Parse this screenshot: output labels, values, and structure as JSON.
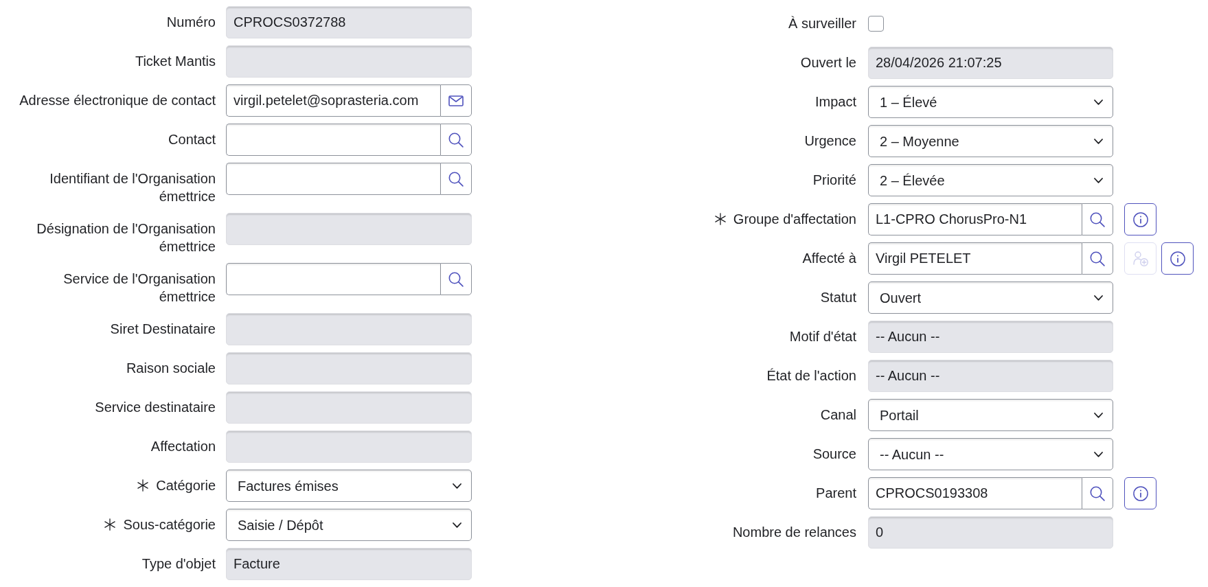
{
  "left_fields": [
    {
      "label": "Numéro",
      "kind": "readonly",
      "required": false,
      "value": "CPROCS0372788"
    },
    {
      "label": "Ticket Mantis",
      "kind": "readonly",
      "required": false
    },
    {
      "label": "Adresse électronique de contact",
      "kind": "email",
      "required": false,
      "value": "virgil.petelet@soprasteria.com"
    },
    {
      "label": "Contact",
      "kind": "lookup",
      "required": false
    },
    {
      "label": "Identifiant de l'Organisation émettrice",
      "kind": "lookup",
      "required": false
    },
    {
      "label": "Désignation de l'Organisation émettrice",
      "kind": "readonly",
      "required": false
    },
    {
      "label": "Service de l'Organisation émettrice",
      "kind": "lookup",
      "required": false
    },
    {
      "label": "Siret Destinataire",
      "kind": "readonly",
      "required": false
    },
    {
      "label": "Raison sociale",
      "kind": "readonly",
      "required": false
    },
    {
      "label": "Service destinataire",
      "kind": "readonly",
      "required": false
    },
    {
      "label": "Affectation",
      "kind": "readonly",
      "required": false
    },
    {
      "label": "Catégorie",
      "kind": "select",
      "required": true,
      "value": "Factures émises"
    },
    {
      "label": "Sous-catégorie",
      "kind": "select",
      "required": true,
      "value": "Saisie / Dépôt"
    },
    {
      "label": "Type d'objet",
      "kind": "readonly",
      "required": false,
      "value": "Facture"
    }
  ],
  "right_fields": [
    {
      "label": "À surveiller",
      "kind": "checkbox",
      "required": false,
      "checked": false
    },
    {
      "label": "Ouvert le",
      "kind": "readonly",
      "required": false,
      "value": "28/04/2026 21:07:25"
    },
    {
      "label": "Impact",
      "kind": "select",
      "required": false,
      "value": "1 – Élevé"
    },
    {
      "label": "Urgence",
      "kind": "select",
      "required": false,
      "value": "2 – Moyenne"
    },
    {
      "label": "Priorité",
      "kind": "select",
      "required": false,
      "value": "2 – Élevée"
    },
    {
      "label": "Groupe d'affectation",
      "kind": "lookup",
      "required": true,
      "value": "L1-CPRO ChorusPro-N1",
      "buttons": [
        {
          "kind": "info",
          "disabled": false
        }
      ]
    },
    {
      "label": "Affecté à",
      "kind": "lookup",
      "required": false,
      "value": "Virgil PETELET",
      "buttons": [
        {
          "kind": "add_user",
          "disabled": true
        },
        {
          "kind": "info",
          "disabled": false
        }
      ]
    },
    {
      "label": "Statut",
      "kind": "select",
      "required": false,
      "value": "Ouvert"
    },
    {
      "label": "Motif d'état",
      "kind": "readonly",
      "required": false,
      "value": "-- Aucun --"
    },
    {
      "label": "État de l'action",
      "kind": "readonly",
      "required": false,
      "value": "-- Aucun --"
    },
    {
      "label": "Canal",
      "kind": "select",
      "required": false,
      "value": "Portail"
    },
    {
      "label": "Source",
      "kind": "select",
      "required": false,
      "value": "-- Aucun --"
    },
    {
      "label": "Parent",
      "kind": "lookup",
      "required": false,
      "value": "CPROCS0193308",
      "buttons": [
        {
          "kind": "info",
          "disabled": false
        }
      ]
    },
    {
      "label": "Nombre de relances",
      "kind": "readonly",
      "required": false,
      "value": "0"
    }
  ]
}
